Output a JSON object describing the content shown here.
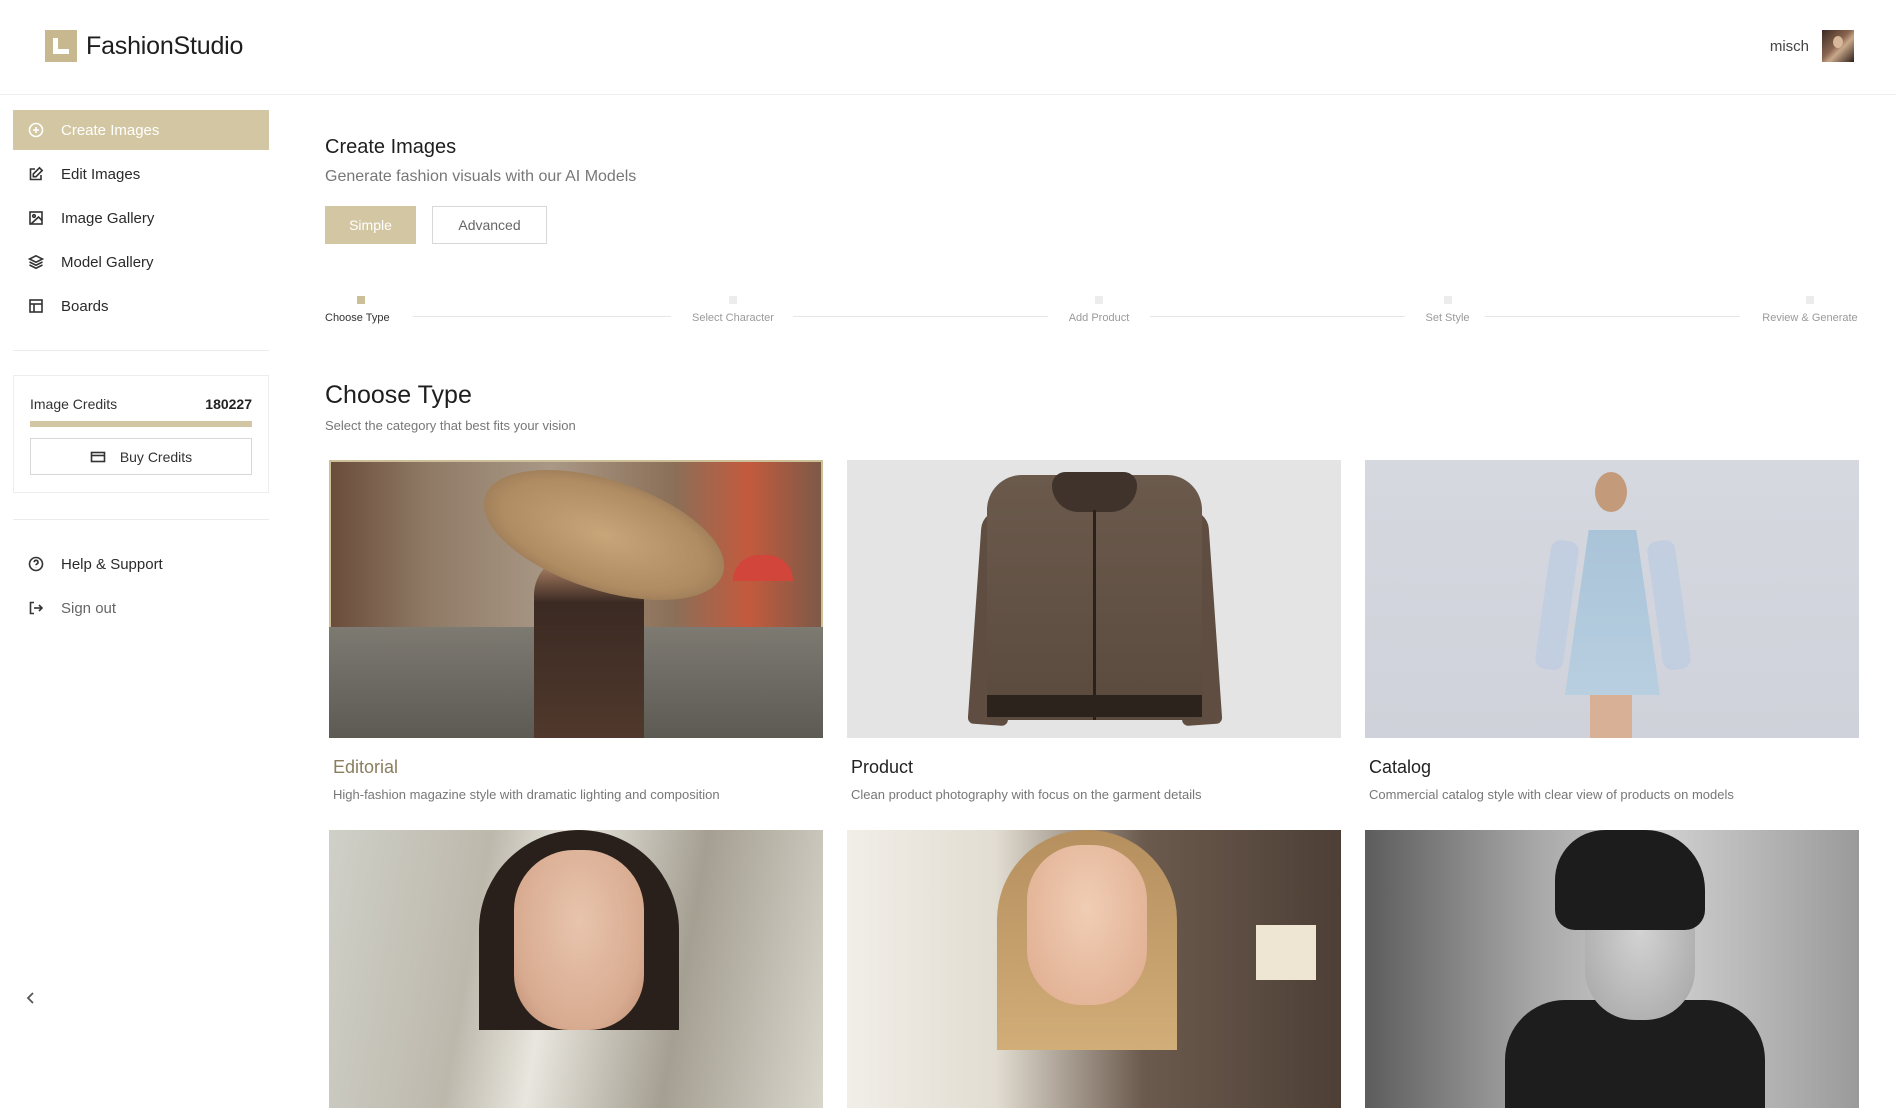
{
  "app": {
    "brand": "FashionStudio",
    "user_name": "misch"
  },
  "sidebar": {
    "items": [
      {
        "label": "Create Images",
        "icon": "plus-circle-icon",
        "active": true
      },
      {
        "label": "Edit Images",
        "icon": "edit-icon",
        "active": false
      },
      {
        "label": "Image Gallery",
        "icon": "image-icon",
        "active": false
      },
      {
        "label": "Model Gallery",
        "icon": "layers-icon",
        "active": false
      },
      {
        "label": "Boards",
        "icon": "layout-icon",
        "active": false
      }
    ],
    "credits": {
      "label": "Image Credits",
      "value": "180227",
      "fill_fraction": 1.0,
      "buy_label": "Buy Credits"
    },
    "footer_items": [
      {
        "label": "Help & Support",
        "icon": "help-circle-icon"
      },
      {
        "label": "Sign out",
        "icon": "sign-out-icon"
      }
    ]
  },
  "main": {
    "title": "Create Images",
    "subtitle": "Generate fashion visuals with our AI Models",
    "modes": {
      "simple": "Simple",
      "advanced": "Advanced",
      "selected": "simple"
    },
    "steps": [
      {
        "label": "Choose Type",
        "active": true
      },
      {
        "label": "Select Character",
        "active": false
      },
      {
        "label": "Add Product",
        "active": false
      },
      {
        "label": "Set Style",
        "active": false
      },
      {
        "label": "Review & Generate",
        "active": false
      }
    ],
    "section_title": "Choose Type",
    "section_subtitle": "Select the category that best fits your vision",
    "cards": [
      {
        "title": "Editorial",
        "description": "High-fashion magazine style with dramatic lighting and composition",
        "selected": true
      },
      {
        "title": "Product",
        "description": "Clean product photography with focus on the garment details",
        "selected": false
      },
      {
        "title": "Catalog",
        "description": "Commercial catalog style with clear view of products on models",
        "selected": false
      }
    ]
  },
  "colors": {
    "accent": "#d3c6a2",
    "accent_dark": "#8a7e5e"
  }
}
